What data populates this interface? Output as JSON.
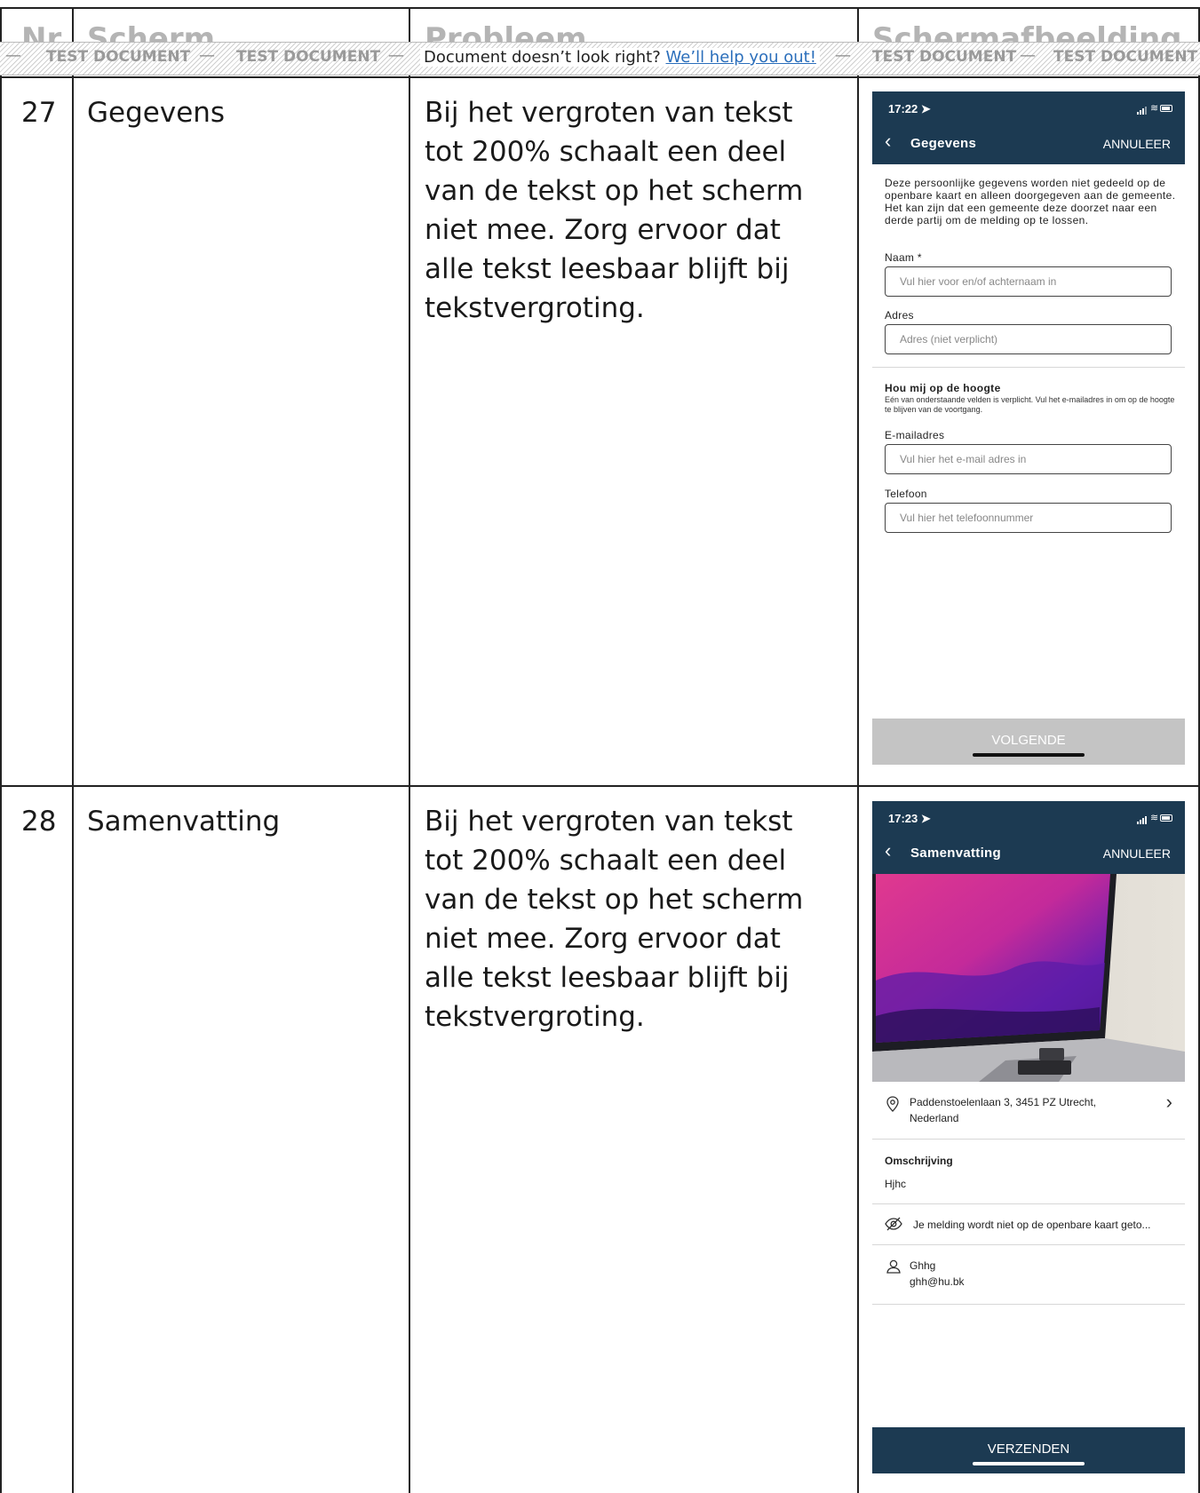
{
  "headers": {
    "nr": "Nr.",
    "scherm": "Scherm",
    "probleem": "Probleem",
    "schermafbeelding": "Schermafbeelding"
  },
  "banner": {
    "watermark": "TEST DOCUMENT",
    "message": "Document doesn’t look right?",
    "link": "We’ll help you out!"
  },
  "rows": [
    {
      "nr": "27",
      "scherm": "Gegevens",
      "probleem": "Bij het vergroten van tekst tot 200% schaalt een deel van de tekst op het scherm niet mee. Zorg ervoor dat alle tekst leesbaar blijft bij tekstvergroting."
    },
    {
      "nr": "28",
      "scherm": "Samenvatting",
      "probleem": "Bij het vergroten van tekst tot 200% schaalt een deel van de tekst op het scherm niet mee. Zorg ervoor dat alle tekst leesbaar blijft bij tekstvergroting."
    }
  ],
  "phone1": {
    "time": "17:22",
    "title": "Gegevens",
    "cancel": "ANNULEER",
    "intro": "Deze persoonlijke gegevens worden niet gedeeld op de openbare kaart en alleen doorgegeven aan de gemeente. Het kan zijn dat een gemeente deze doorzet naar een derde partij om de melding op te lossen.",
    "naam_label": "Naam *",
    "naam_placeholder": "Vul hier voor en/of achternaam in",
    "adres_label": "Adres",
    "adres_placeholder": "Adres (niet verplicht)",
    "section_title": "Hou mij op de hoogte",
    "section_text": "Eén van onderstaande velden is verplicht. Vul het e-mailadres in om op de hoogte te blijven van de voortgang.",
    "email_label": "E-mailadres",
    "email_placeholder": "Vul hier het e-mail adres in",
    "telefoon_label": "Telefoon",
    "telefoon_placeholder": "Vul hier het telefoonnummer",
    "button": "VOLGENDE"
  },
  "phone2": {
    "time": "17:23",
    "title": "Samenvatting",
    "cancel": "ANNULEER",
    "address_line1": "Paddenstoelenlaan 3, 3451 PZ Utrecht,",
    "address_line2": "Nederland",
    "omschrijving_label": "Omschrijving",
    "omschrijving_value": "Hjhc",
    "privacy_text": "Je melding wordt niet op de openbare kaart geto...",
    "contact_name": "Ghhg",
    "contact_email": "ghh@hu.bk",
    "button": "VERZENDEN"
  },
  "colors": {
    "navy": "#1c3a52",
    "disabled_button": "#c4c4c4",
    "link": "#2a6ebb"
  }
}
